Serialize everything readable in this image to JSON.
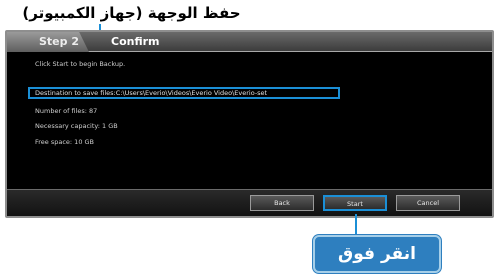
{
  "callouts": {
    "top_label": "حفظ الوجهة (جهاز الكمبيوتر)",
    "click_label": "انقر فوق"
  },
  "tabs": {
    "step": "Step 2",
    "current": "Confirm"
  },
  "content": {
    "instruction": "Click Start to begin Backup.",
    "destination": "Destination to save files:C:\\Users\\Everio\\Videos\\Everio Video\\Everio-set",
    "files": "Number of files:  87",
    "capacity": "Necessary capacity:  1 GB",
    "free_space": "Free space:  10 GB"
  },
  "buttons": {
    "back": "Back",
    "start": "Start",
    "cancel": "Cancel"
  },
  "colors": {
    "highlight": "#1b8fd6",
    "callout_bg": "#2e7fbf"
  }
}
